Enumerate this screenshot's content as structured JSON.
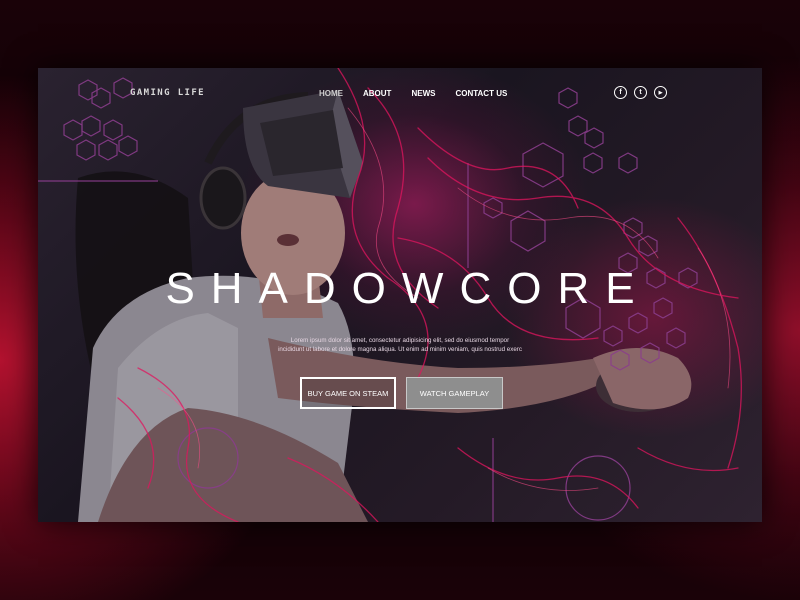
{
  "header": {
    "logo": "GAMING LIFE",
    "nav": [
      "HOME",
      "ABOUT",
      "NEWS",
      "CONTACT US"
    ],
    "social": [
      {
        "icon": "facebook-icon",
        "glyph": "f"
      },
      {
        "icon": "twitter-icon",
        "glyph": "t"
      },
      {
        "icon": "youtube-icon",
        "glyph": "▶"
      }
    ]
  },
  "hero": {
    "title": "SHADOWCORE",
    "text": "Lorem ipsum dolor sit amet, consectetur adipisicing elit, sed do eiusmod tempor incididunt ut labore et dolore magna aliqua. Ut enim ad minim veniam, quis nostrud exerc",
    "buy_button": "BUY GAME ON STEAM",
    "watch_button": "WATCH GAMEPLAY"
  },
  "colors": {
    "accent": "#d4145a",
    "hex_stroke": "#8a3d8c",
    "background": "#0a0206"
  }
}
